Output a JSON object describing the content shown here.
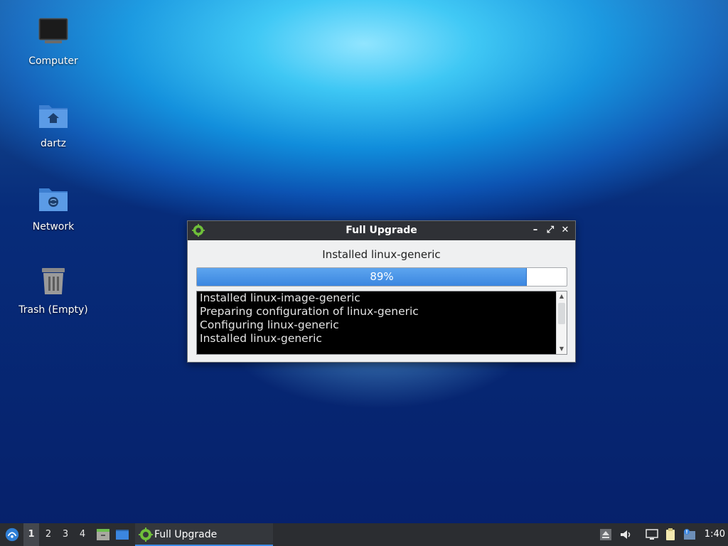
{
  "desktop": {
    "icons": [
      {
        "label": "Computer",
        "icon": "computer-icon"
      },
      {
        "label": "dartz",
        "icon": "home-folder-icon"
      },
      {
        "label": "Network",
        "icon": "network-folder-icon"
      },
      {
        "label": "Trash (Empty)",
        "icon": "trash-icon"
      }
    ]
  },
  "dialog": {
    "title": "Full Upgrade",
    "status": "Installed linux-generic",
    "progress_text": "89%",
    "progress_value": 0.89,
    "log_lines": [
      "Installed linux-image-generic",
      "Preparing configuration of linux-generic",
      "Configuring linux-generic",
      "Installed linux-generic"
    ],
    "buttons": {
      "minimize": "–",
      "maximize": "⤢",
      "close": "✕"
    }
  },
  "taskbar": {
    "workspaces": [
      "1",
      "2",
      "3",
      "4"
    ],
    "active_workspace": "1",
    "task_label": "Full Upgrade",
    "clock": "1:40"
  },
  "colors": {
    "accent": "#3b86e0",
    "titlebar": "#2f3136",
    "taskbar": "#2b2d31"
  }
}
